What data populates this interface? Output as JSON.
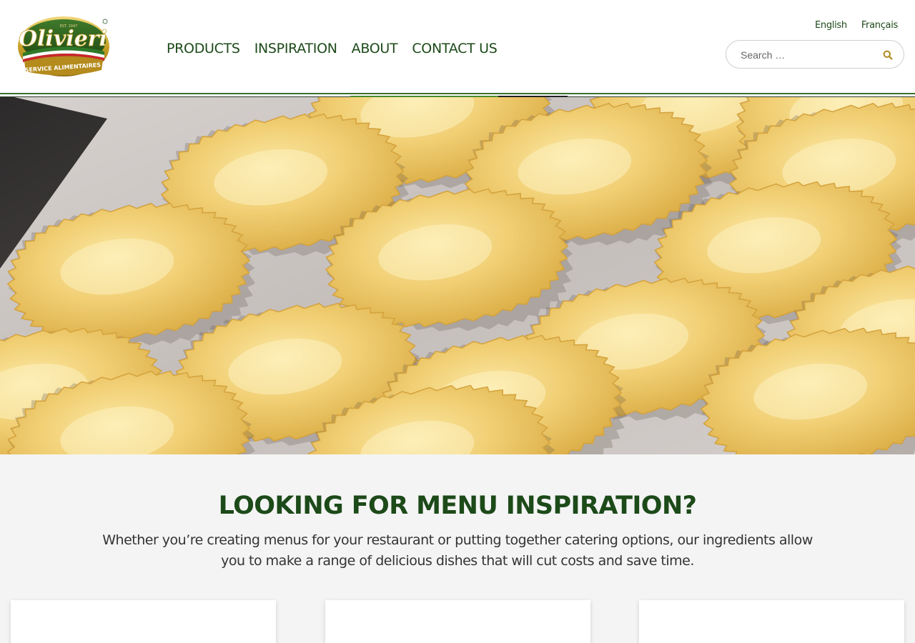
{
  "brand": {
    "name": "Olivieri",
    "est": "EST. 1947",
    "tagline": "SERVICE ALIMENTAIRES",
    "colors": {
      "primary_green": "#1c4a19",
      "accent_gold": "#c9a227",
      "background": "#f4f4f4"
    }
  },
  "nav": {
    "items": [
      {
        "label": "PRODUCTS"
      },
      {
        "label": "INSPIRATION"
      },
      {
        "label": "ABOUT"
      },
      {
        "label": "CONTACT US"
      }
    ]
  },
  "languages": {
    "english": "English",
    "french": "Français"
  },
  "search": {
    "placeholder": "Search …",
    "value": "",
    "icon": "search-icon"
  },
  "slider": {
    "progress": 0.68
  },
  "hero": {
    "image": "ravioli-on-baking-sheet"
  },
  "inspiration": {
    "title": "LOOKING FOR MENU INSPIRATION?",
    "body": "Whether you’re creating menus for your restaurant or putting together catering options, our ingredients allow you to make a range of delicious dishes that will cut costs and save time."
  },
  "cards": [
    {
      "id": "card-1"
    },
    {
      "id": "card-2"
    },
    {
      "id": "card-3"
    }
  ]
}
